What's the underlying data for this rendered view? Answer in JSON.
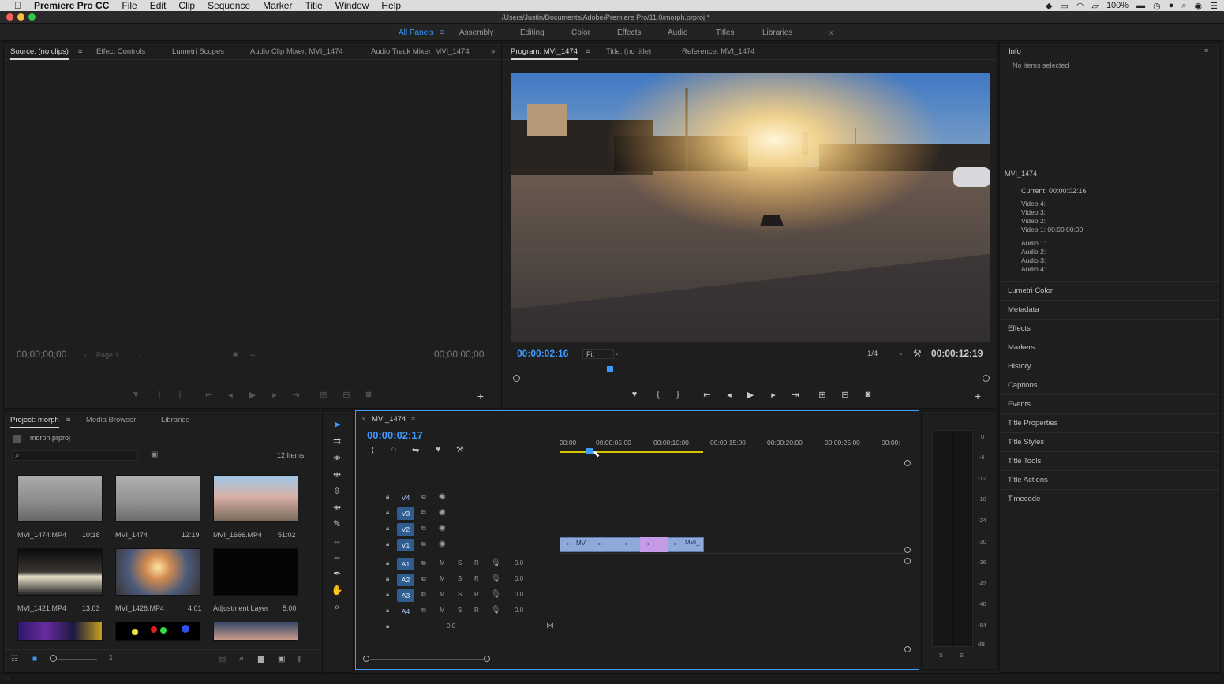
{
  "menubar": {
    "app": "Premiere Pro CC",
    "items": [
      "File",
      "Edit",
      "Clip",
      "Sequence",
      "Marker",
      "Title",
      "Window",
      "Help"
    ],
    "battery": "100%"
  },
  "window": {
    "path": "/Users/Justin/Documents/Adobe/Premiere Pro/11.0/morph.prproj *"
  },
  "workspaces": {
    "tabs": [
      "All Panels",
      "Assembly",
      "Editing",
      "Color",
      "Effects",
      "Audio",
      "Titles",
      "Libraries"
    ],
    "active": "All Panels"
  },
  "source": {
    "tabs": [
      "Source: (no clips)",
      "Effect Controls",
      "Lumetri Scopes",
      "Audio Clip Mixer: MVI_1474",
      "Audio Track Mixer: MVI_1474"
    ],
    "tc_in": "00;00;00;00",
    "tc_out": "00;00;00;00",
    "page": "Page 1"
  },
  "program": {
    "tabs": [
      "Program: MVI_1474",
      "Title: (no title)",
      "Reference: MVI_1474"
    ],
    "tc_current": "00:00:02:16",
    "fit": "Fit",
    "res": "1/4",
    "tc_duration": "00:00:12:19",
    "playhead_frac": 0.2
  },
  "info": {
    "title": "Info",
    "no_items": "No items selected",
    "clip": "MVI_1474",
    "current": "Current: 00:00:02:16",
    "video": [
      "Video 4:",
      "Video 3:",
      "Video 2:",
      "Video 1: 00:00:00:00"
    ],
    "audio": [
      "Audio 1:",
      "Audio 2:",
      "Audio 3:",
      "Audio 4:"
    ],
    "panels": [
      "Lumetri Color",
      "Metadata",
      "Effects",
      "Markers",
      "History",
      "Captions",
      "Events",
      "Title Properties",
      "Title Styles",
      "Title Tools",
      "Title Actions",
      "Timecode"
    ]
  },
  "project": {
    "tabs": [
      "Project: morph",
      "Media Browser",
      "Libraries"
    ],
    "file": "morph.prproj",
    "count": "12 Items",
    "items": [
      {
        "name": "MVI_1474.MP4",
        "dur": "10:18"
      },
      {
        "name": "MVI_1474",
        "dur": "12:19"
      },
      {
        "name": "MVI_1666.MP4",
        "dur": "51:02"
      },
      {
        "name": "MVI_1421.MP4",
        "dur": "13:03"
      },
      {
        "name": "MVI_1426.MP4",
        "dur": "4:01"
      },
      {
        "name": "Adjustment Layer",
        "dur": "5:00"
      }
    ]
  },
  "timeline": {
    "seq": "MVI_1474",
    "tc": "00:00:02:17",
    "ruler": [
      "00:00",
      "00:00:05:00",
      "00:00:10:00",
      "00:00:15:00",
      "00:00:20:00",
      "00:00:25:00",
      "00:00:"
    ],
    "video_tracks": [
      "V4",
      "V3",
      "V2",
      "V1"
    ],
    "audio_tracks": [
      "A1",
      "A2",
      "A3",
      "A4"
    ],
    "mute": "M",
    "solo": "S",
    "rec": "R",
    "vol": "0.0",
    "master_vol": "0.0",
    "clip_labels": [
      "MV",
      "MVI_"
    ]
  },
  "meter": {
    "scale": [
      "0",
      "-6",
      "-12",
      "-18",
      "-24",
      "-30",
      "-36",
      "-42",
      "-48",
      "-54",
      "dB"
    ],
    "solo": [
      "S",
      "S"
    ]
  },
  "colors": {
    "accent": "#3d9bff",
    "clip_video": "#8fa9d9",
    "clip_pink": "#c59ae6",
    "track_on": "#2f5d8f"
  }
}
